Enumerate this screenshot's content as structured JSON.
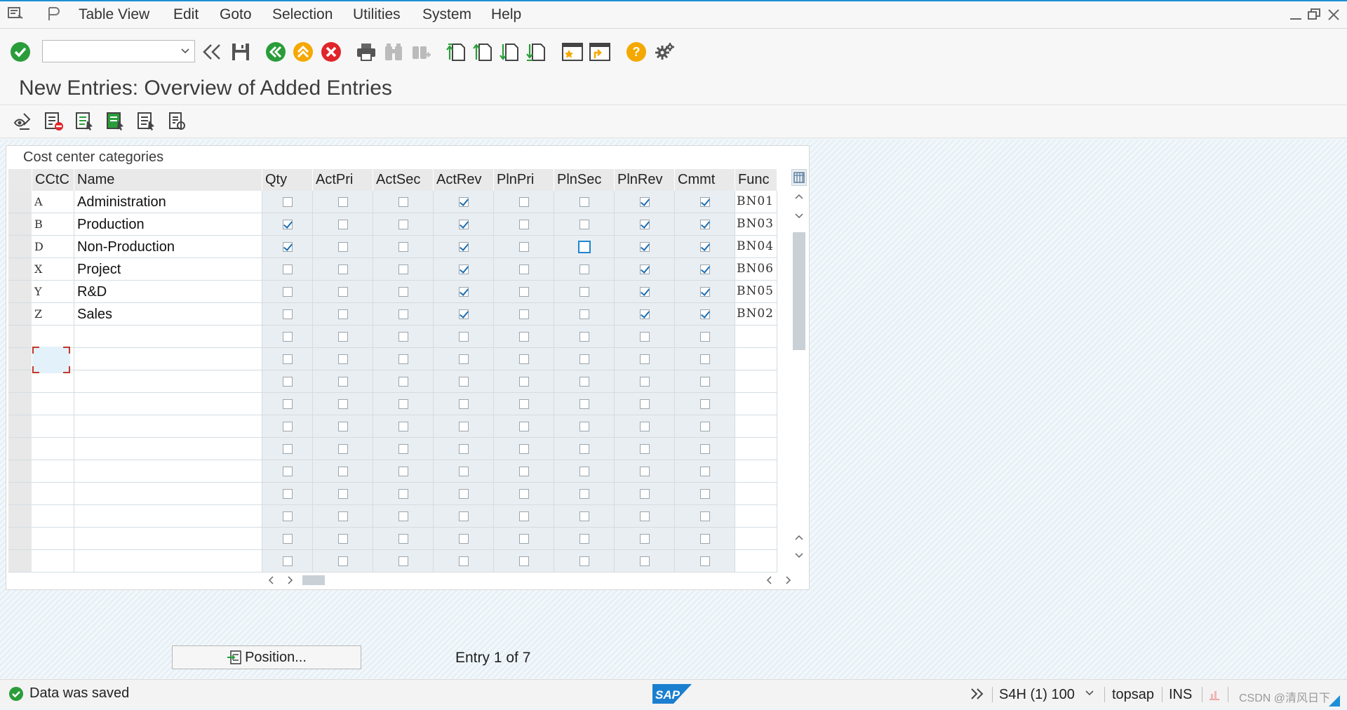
{
  "menu": {
    "items": [
      "Table View",
      "Edit",
      "Goto",
      "Selection",
      "Utilities",
      "System",
      "Help"
    ]
  },
  "toolbar": {
    "command_value": ""
  },
  "screen": {
    "title": "New Entries: Overview of Added Entries"
  },
  "table": {
    "title": "Cost center categories",
    "columns": [
      "CCtC",
      "Name",
      "Qty",
      "ActPri",
      "ActSec",
      "ActRev",
      "PlnPri",
      "PlnSec",
      "PlnRev",
      "Cmmt",
      "Func"
    ],
    "rows": [
      {
        "key": "A",
        "name": "Administration",
        "checks": [
          false,
          false,
          false,
          true,
          false,
          false,
          true,
          true
        ],
        "func": "BN01"
      },
      {
        "key": "B",
        "name": "Production",
        "checks": [
          true,
          false,
          false,
          true,
          false,
          false,
          true,
          true
        ],
        "func": "BN03"
      },
      {
        "key": "D",
        "name": "Non-Production",
        "checks": [
          true,
          false,
          false,
          true,
          false,
          false,
          true,
          true
        ],
        "func": "BN04"
      },
      {
        "key": "X",
        "name": "Project",
        "checks": [
          false,
          false,
          false,
          true,
          false,
          false,
          true,
          true
        ],
        "func": "BN06"
      },
      {
        "key": "Y",
        "name": "R&D",
        "checks": [
          false,
          false,
          false,
          true,
          false,
          false,
          true,
          true
        ],
        "func": "BN05"
      },
      {
        "key": "Z",
        "name": "Sales",
        "checks": [
          false,
          false,
          false,
          true,
          false,
          false,
          true,
          true
        ],
        "func": "BN02"
      }
    ],
    "empty_rows": 11
  },
  "footer": {
    "position_label": "Position...",
    "entry_info": "Entry 1 of 7"
  },
  "status": {
    "message": "Data was saved",
    "system": "S4H (1) 100",
    "server": "topsap",
    "mode": "INS",
    "watermark": "CSDN @清风日下"
  },
  "colors": {
    "accent": "#1e8fd6",
    "success": "#2a9d3a",
    "error": "#e0262b",
    "warning": "#f5a800"
  }
}
